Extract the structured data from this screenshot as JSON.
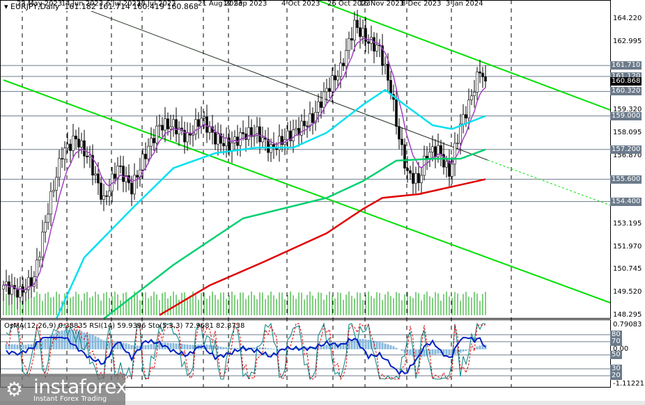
{
  "header": {
    "symbol": "EURJPY,Daily",
    "ohlc": "161.182 161.714 160.419 160.868"
  },
  "indicator_header": "OsMA(12,26,9) 0.38835  RSI(14) 59.9396  Sto(5,3,3) 72.9681 82.8738",
  "logo": {
    "brand": "instaforex",
    "tagline": "Instant Forex Trading"
  },
  "colors": {
    "bull": "#00a000",
    "ma_fast": "#a040c0",
    "ma_mid": "#00e0f0",
    "ma_slow": "#00d070",
    "ma_200": "#e00000",
    "channel": "#00e000",
    "histogram": "#87b8dc"
  },
  "chart_data": {
    "type": "candlestick",
    "title": "EURJPY, Daily",
    "ylim": [
      148.295,
      164.22
    ],
    "y_ticks": [
      "164.220",
      "162.995",
      "159.320",
      "158.095",
      "156.870",
      "153.195",
      "151.970",
      "150.745",
      "149.520",
      "148.295"
    ],
    "x_ticks": [
      "23 May 2023",
      "14 Jun 2023",
      "6 Jul 2023",
      "28 Jul 2023",
      "21 Aug 2023",
      "12 Sep 2023",
      "4 Oct 2023",
      "26 Oct 2023",
      "16 Nov 2023",
      "8 Dec 2023",
      "3 Jan 2024"
    ],
    "levels": [
      {
        "label": "161.710",
        "v": 161.71
      },
      {
        "label": "161.120",
        "v": 161.12
      },
      {
        "label": "160.320",
        "v": 160.32
      },
      {
        "label": "159.000",
        "v": 159.0
      },
      {
        "label": "157.200",
        "v": 157.2
      },
      {
        "label": "155.600",
        "v": 155.6
      },
      {
        "label": "154.400",
        "v": 154.4
      }
    ],
    "current_price": "160.868",
    "close_path": [
      [
        0,
        149.9
      ],
      [
        6,
        149.5
      ],
      [
        11,
        150.3
      ],
      [
        16,
        154.0
      ],
      [
        21,
        157.0
      ],
      [
        26,
        157.8
      ],
      [
        31,
        156.6
      ],
      [
        36,
        154.4
      ],
      [
        41,
        156.3
      ],
      [
        46,
        155.1
      ],
      [
        51,
        157.0
      ],
      [
        56,
        158.5
      ],
      [
        61,
        158.5
      ],
      [
        66,
        157.8
      ],
      [
        71,
        158.9
      ],
      [
        76,
        157.8
      ],
      [
        81,
        157.4
      ],
      [
        86,
        158.0
      ],
      [
        91,
        158.1
      ],
      [
        96,
        157.2
      ],
      [
        101,
        157.8
      ],
      [
        106,
        158.3
      ],
      [
        111,
        158.9
      ],
      [
        116,
        160.4
      ],
      [
        121,
        161.5
      ],
      [
        126,
        163.9
      ],
      [
        131,
        163.0
      ],
      [
        135,
        162.6
      ],
      [
        139,
        160.4
      ],
      [
        142,
        157.8
      ],
      [
        145,
        155.9
      ],
      [
        149,
        155.5
      ],
      [
        152,
        157.0
      ],
      [
        156,
        157.2
      ],
      [
        160,
        155.9
      ],
      [
        164,
        158.5
      ],
      [
        167,
        159.6
      ],
      [
        171,
        161.5
      ],
      [
        173,
        160.868
      ]
    ],
    "ma_50": [
      [
        19,
        148.1
      ],
      [
        29,
        151.4
      ],
      [
        46,
        154.0
      ],
      [
        61,
        156.2
      ],
      [
        76,
        157.0
      ],
      [
        91,
        157.3
      ],
      [
        104,
        157.3
      ],
      [
        116,
        158.1
      ],
      [
        129,
        159.6
      ],
      [
        137,
        160.4
      ],
      [
        144,
        159.6
      ],
      [
        154,
        158.5
      ],
      [
        161,
        158.3
      ],
      [
        173,
        159.0
      ]
    ],
    "ma_144": [
      [
        36,
        148.0
      ],
      [
        61,
        151.0
      ],
      [
        86,
        153.5
      ],
      [
        116,
        154.6
      ],
      [
        129,
        155.5
      ],
      [
        141,
        156.6
      ],
      [
        154,
        156.7
      ],
      [
        164,
        156.7
      ],
      [
        173,
        157.2
      ]
    ],
    "ma_200": [
      [
        56,
        148.3
      ],
      [
        74,
        149.9
      ],
      [
        94,
        151.2
      ],
      [
        116,
        152.7
      ],
      [
        129,
        154.0
      ],
      [
        136,
        154.6
      ],
      [
        149,
        154.8
      ],
      [
        161,
        155.2
      ],
      [
        173,
        155.6
      ]
    ],
    "indicator": {
      "top": "0.79083",
      "zero": "0.00",
      "bottom": "-1.11221",
      "levels": [
        "80",
        "70",
        "50",
        "30",
        "20"
      ]
    }
  }
}
